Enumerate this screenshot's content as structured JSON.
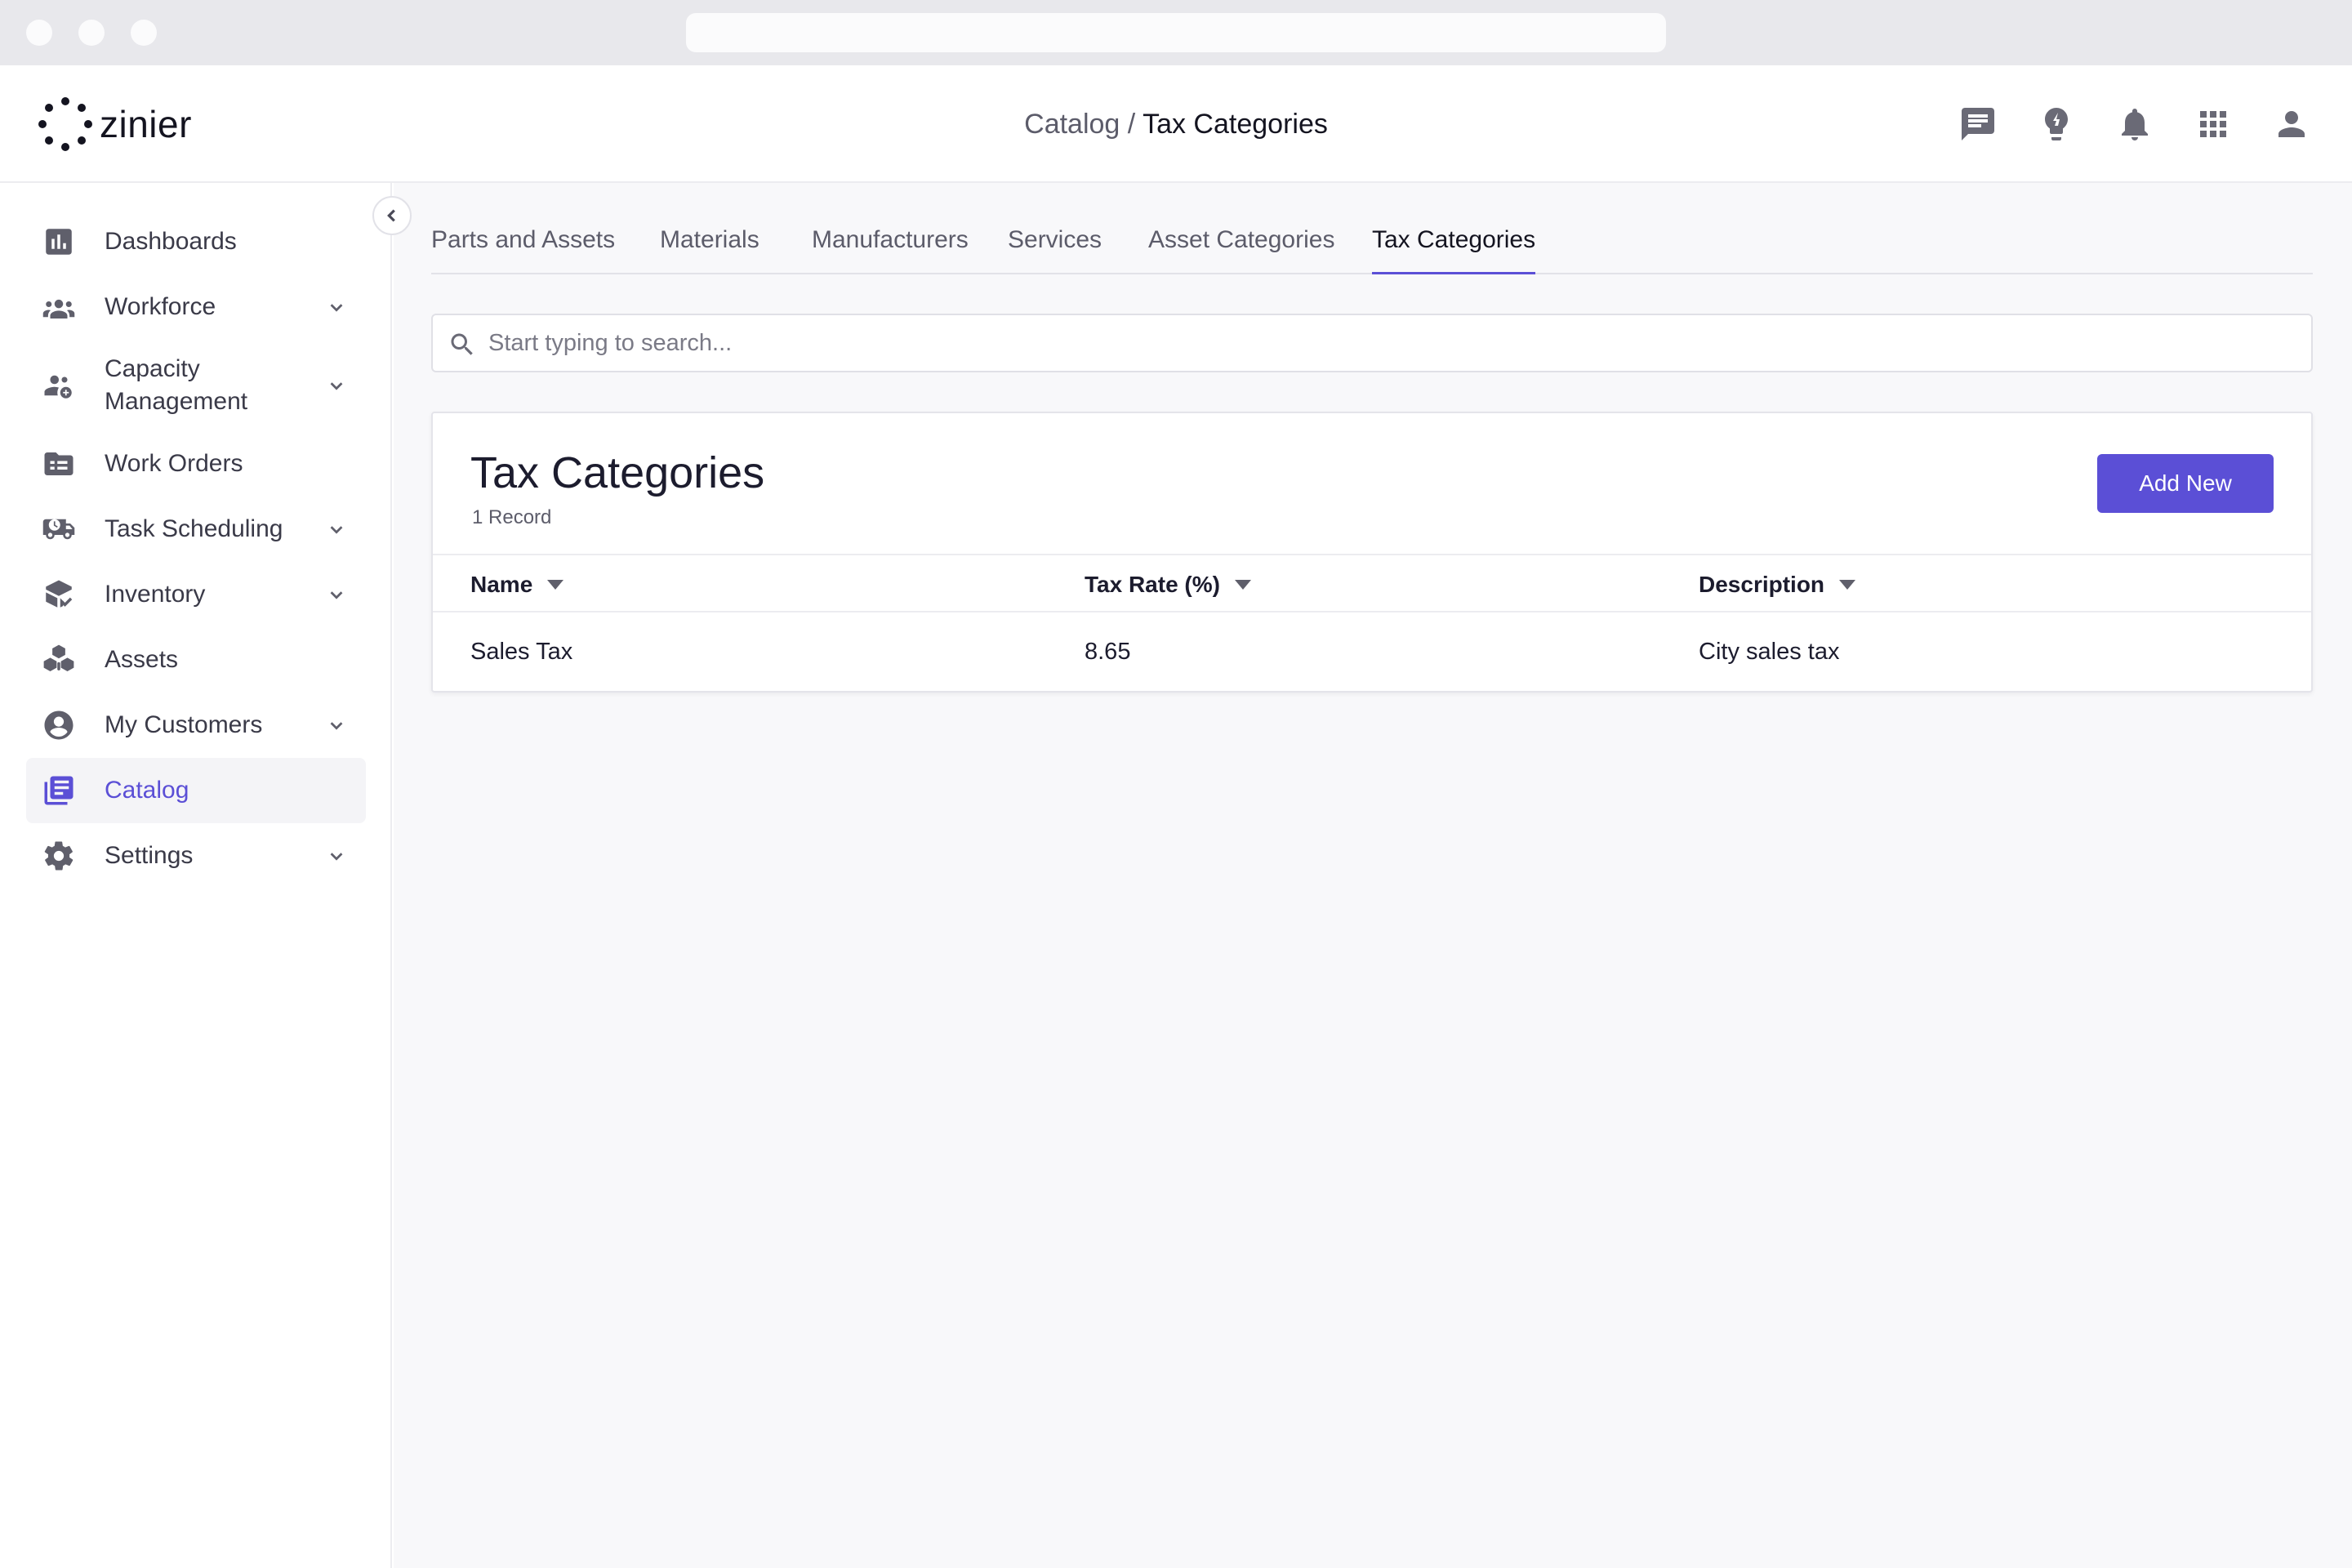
{
  "app": {
    "brand": "zinier"
  },
  "breadcrumb": {
    "parent": "Catalog",
    "separator": " / ",
    "current": "Tax Categories"
  },
  "header_icons": [
    "chat-icon",
    "lightbulb-icon",
    "bell-icon",
    "apps-grid-icon",
    "user-icon"
  ],
  "sidebar": {
    "items": [
      {
        "label": "Dashboards",
        "icon": "bar-chart-icon",
        "has_submenu": false
      },
      {
        "label": "Workforce",
        "icon": "people-icon",
        "has_submenu": true
      },
      {
        "label": "Capacity Management",
        "icon": "people-add-icon",
        "has_submenu": true
      },
      {
        "label": "Work Orders",
        "icon": "folder-list-icon",
        "has_submenu": false
      },
      {
        "label": "Task Scheduling",
        "icon": "truck-clock-icon",
        "has_submenu": true
      },
      {
        "label": "Inventory",
        "icon": "box-check-icon",
        "has_submenu": true
      },
      {
        "label": "Assets",
        "icon": "cubes-icon",
        "has_submenu": false
      },
      {
        "label": "My Customers",
        "icon": "account-circle-icon",
        "has_submenu": true
      },
      {
        "label": "Catalog",
        "icon": "book-icon",
        "has_submenu": false,
        "active": true
      },
      {
        "label": "Settings",
        "icon": "gear-icon",
        "has_submenu": true
      }
    ]
  },
  "tabs": [
    {
      "label": "Parts and Assets",
      "active": false
    },
    {
      "label": "Materials",
      "active": false
    },
    {
      "label": "Manufacturers",
      "active": false
    },
    {
      "label": "Services",
      "active": false
    },
    {
      "label": "Asset Categories",
      "active": false
    },
    {
      "label": "Tax Categories",
      "active": true
    }
  ],
  "search": {
    "placeholder": "Start typing to search...",
    "value": ""
  },
  "card": {
    "title": "Tax Categories",
    "record_count": "1 Record",
    "add_label": "Add New"
  },
  "table": {
    "columns": [
      "Name",
      "Tax Rate (%)",
      "Description"
    ],
    "rows": [
      [
        "Sales Tax",
        "8.65",
        "City sales tax"
      ]
    ]
  },
  "colors": {
    "accent": "#5b4fd6",
    "text": "#1c1c2e",
    "muted": "#5c5c6a",
    "background": "#f8f8fa"
  }
}
